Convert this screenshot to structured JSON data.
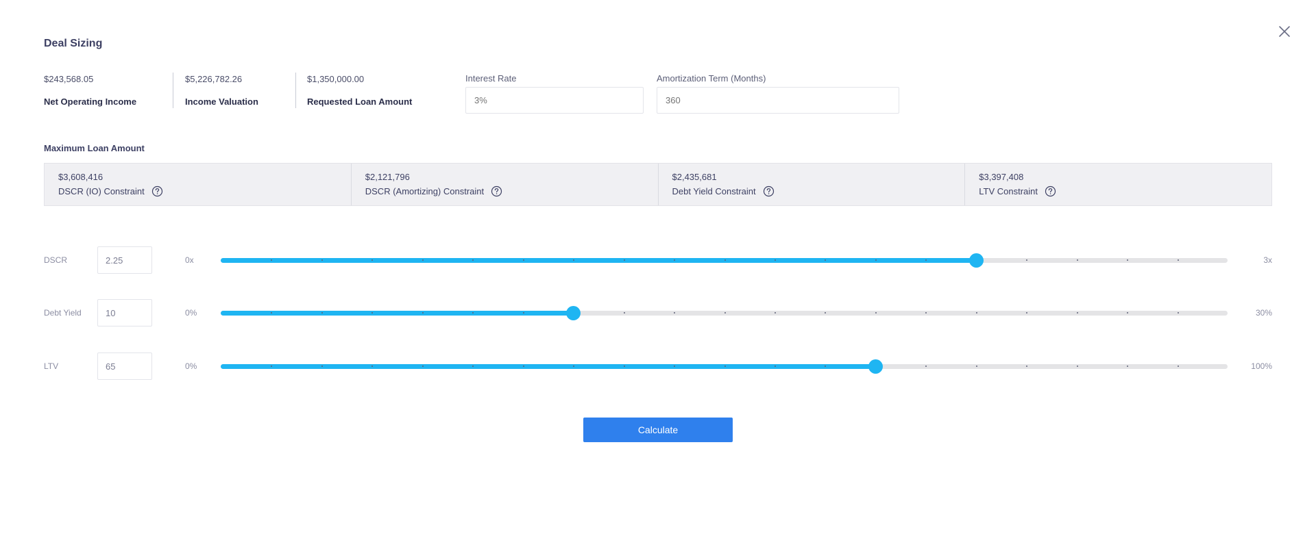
{
  "modal": {
    "title": "Deal Sizing",
    "close_icon": "close-icon"
  },
  "summary": [
    {
      "value": "$243,568.05",
      "label": "Net Operating Income"
    },
    {
      "value": "$5,226,782.26",
      "label": "Income Valuation"
    },
    {
      "value": "$1,350,000.00",
      "label": "Requested Loan Amount"
    }
  ],
  "fields": {
    "interest_rate": {
      "label": "Interest Rate",
      "placeholder": "3%"
    },
    "amortization": {
      "label": "Amortization Term (Months)",
      "placeholder": "360"
    }
  },
  "max_loan": {
    "heading": "Maximum Loan Amount",
    "help_icon": "question-circle-icon",
    "constraints": [
      {
        "value": "$3,608,416",
        "label": "DSCR (IO) Constraint"
      },
      {
        "value": "$2,121,796",
        "label": "DSCR (Amortizing) Constraint"
      },
      {
        "value": "$2,435,681",
        "label": "Debt Yield Constraint"
      },
      {
        "value": "$3,397,408",
        "label": "LTV Constraint"
      }
    ]
  },
  "sliders": [
    {
      "label": "DSCR",
      "value": "2.25",
      "min_label": "0x",
      "max_label": "3x",
      "position_fraction": 0.75
    },
    {
      "label": "Debt Yield",
      "value": "10",
      "min_label": "0%",
      "max_label": "30%",
      "position_fraction": 0.35
    },
    {
      "label": "LTV",
      "value": "65",
      "min_label": "0%",
      "max_label": "100%",
      "position_fraction": 0.65
    }
  ],
  "actions": {
    "calculate_label": "Calculate"
  },
  "colors": {
    "slider_accent": "#1fb5f2",
    "primary_button": "#2f80ed",
    "panel_bg": "#f0f0f3"
  }
}
